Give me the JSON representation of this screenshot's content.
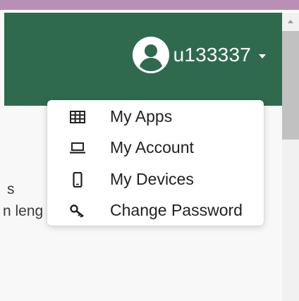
{
  "header": {
    "username": "u133337",
    "avatar_icon": "user-circle-icon",
    "caret_icon": "caret-down-icon",
    "background_color": "#2f6a4f"
  },
  "top_stripe_color": "#b98fb7",
  "background_text": {
    "line1": "s",
    "line2": "n leng"
  },
  "user_dropdown": {
    "items": [
      {
        "label": "My Apps",
        "icon": "table-grid-icon"
      },
      {
        "label": "My Account",
        "icon": "laptop-icon"
      },
      {
        "label": "My Devices",
        "icon": "mobile-phone-icon"
      },
      {
        "label": "Change Password",
        "icon": "key-icon"
      }
    ]
  },
  "scrollbar": {
    "up_arrow_icon": "scroll-up-arrow-icon"
  }
}
